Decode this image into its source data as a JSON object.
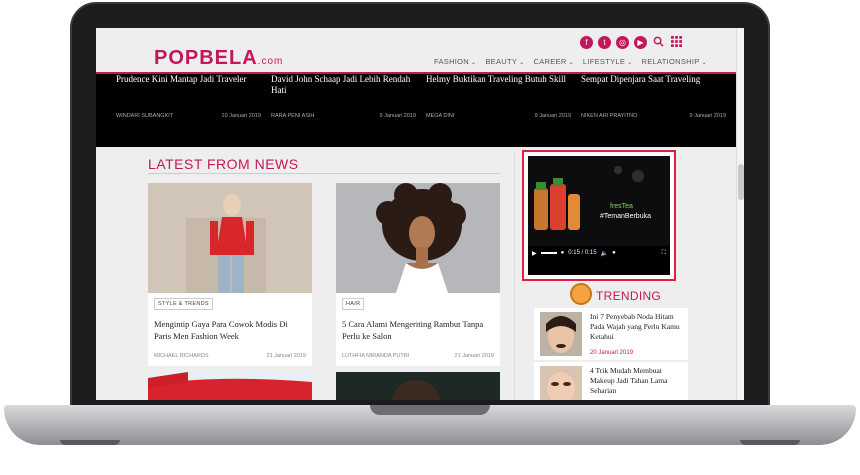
{
  "site": {
    "logo": "POPBELA",
    "logo_suffix": ".com",
    "accent_color": "#c2185b"
  },
  "header_icons": [
    "f-icon",
    "t-icon",
    "ig-icon",
    "yt-icon",
    "search-icon",
    "grid-icon"
  ],
  "nav": [
    {
      "label": "FASHION"
    },
    {
      "label": "BEAUTY"
    },
    {
      "label": "CAREER"
    },
    {
      "label": "LIFESTYLE"
    },
    {
      "label": "RELATIONSHIP"
    }
  ],
  "slider": [
    {
      "title": "Prudence Kini Mantap Jadi Traveler",
      "author": "WINDARI SUBANGKIT",
      "date": "10 Januari 2019"
    },
    {
      "title": "David John Schaap Jadi Lebih Rendah Hati",
      "author": "RARA PENI ASIH",
      "date": "9 Januari 2019"
    },
    {
      "title": "Helmy Buktikan Traveling Butuh Skill",
      "author": "MEGA DINI",
      "date": "9 Januari 2019"
    },
    {
      "title": "Sempat Dipenjara Saat Traveling",
      "author": "NIKEN ARI PRAYITNO",
      "date": "9 Januari 2019"
    }
  ],
  "latest": {
    "title": "LATEST FROM NEWS",
    "cards": [
      {
        "tag": "STYLE & TRENDS",
        "title": "Mengintip Gaya Para Cowok Modis Di Paris Men Fashion Week",
        "author": "MICHAEL RICHARDS",
        "date": "21 Januari 2019"
      },
      {
        "tag": "HAIR",
        "title": "5 Cara Alami Mengeriting Rambut Tanpa Perlu ke Salon",
        "author": "LUTHFIA MIRANDA PUTRI",
        "date": "21 Januari 2019"
      }
    ]
  },
  "video": {
    "time": "0:15 / 0:15",
    "overlay_text": "#TemanBerbuka",
    "brand": "fresTea"
  },
  "trending": {
    "title": "TRENDING",
    "items": [
      {
        "title": "Ini 7 Penyebab Noda Hitam Pada Wajah yang Perlu Kamu Ketahui",
        "date": "20 Januari 2019"
      },
      {
        "title": "4 Trik Mudah Membuat Makeup Jadi Tahan Lama Seharian",
        "date": ""
      }
    ]
  }
}
